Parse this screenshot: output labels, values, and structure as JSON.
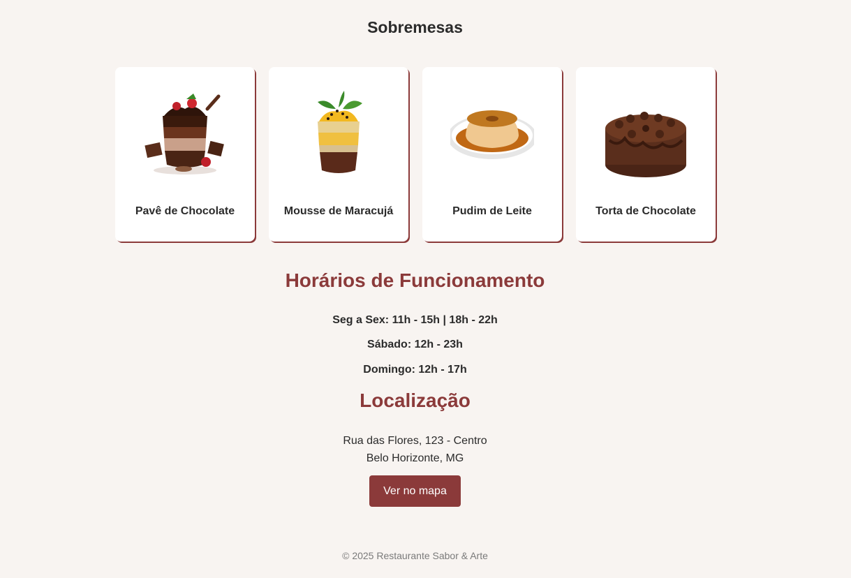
{
  "desserts": {
    "title": "Sobremesas",
    "items": [
      {
        "name": "Pavê de Chocolate",
        "image": "chocolate-trifle-image"
      },
      {
        "name": "Mousse de Maracujá",
        "image": "passion-fruit-mousse-image"
      },
      {
        "name": "Pudim de Leite",
        "image": "flan-pudding-image"
      },
      {
        "name": "Torta de Chocolate",
        "image": "chocolate-cake-image"
      }
    ]
  },
  "hours": {
    "title": "Horários de Funcionamento",
    "lines": [
      "Seg a Sex: 11h - 15h | 18h - 22h",
      "Sábado: 12h - 23h",
      "Domingo: 12h - 17h"
    ]
  },
  "location": {
    "title": "Localização",
    "address_line1": "Rua das Flores, 123 - Centro",
    "address_line2": "Belo Horizonte, MG",
    "map_button": "Ver no mapa"
  },
  "footer": {
    "text": "© 2025 Restaurante Sabor & Arte"
  },
  "colors": {
    "background": "#f8f4f1",
    "accent": "#8b3a3a",
    "card": "#ffffff",
    "text": "#2b2b2b"
  }
}
